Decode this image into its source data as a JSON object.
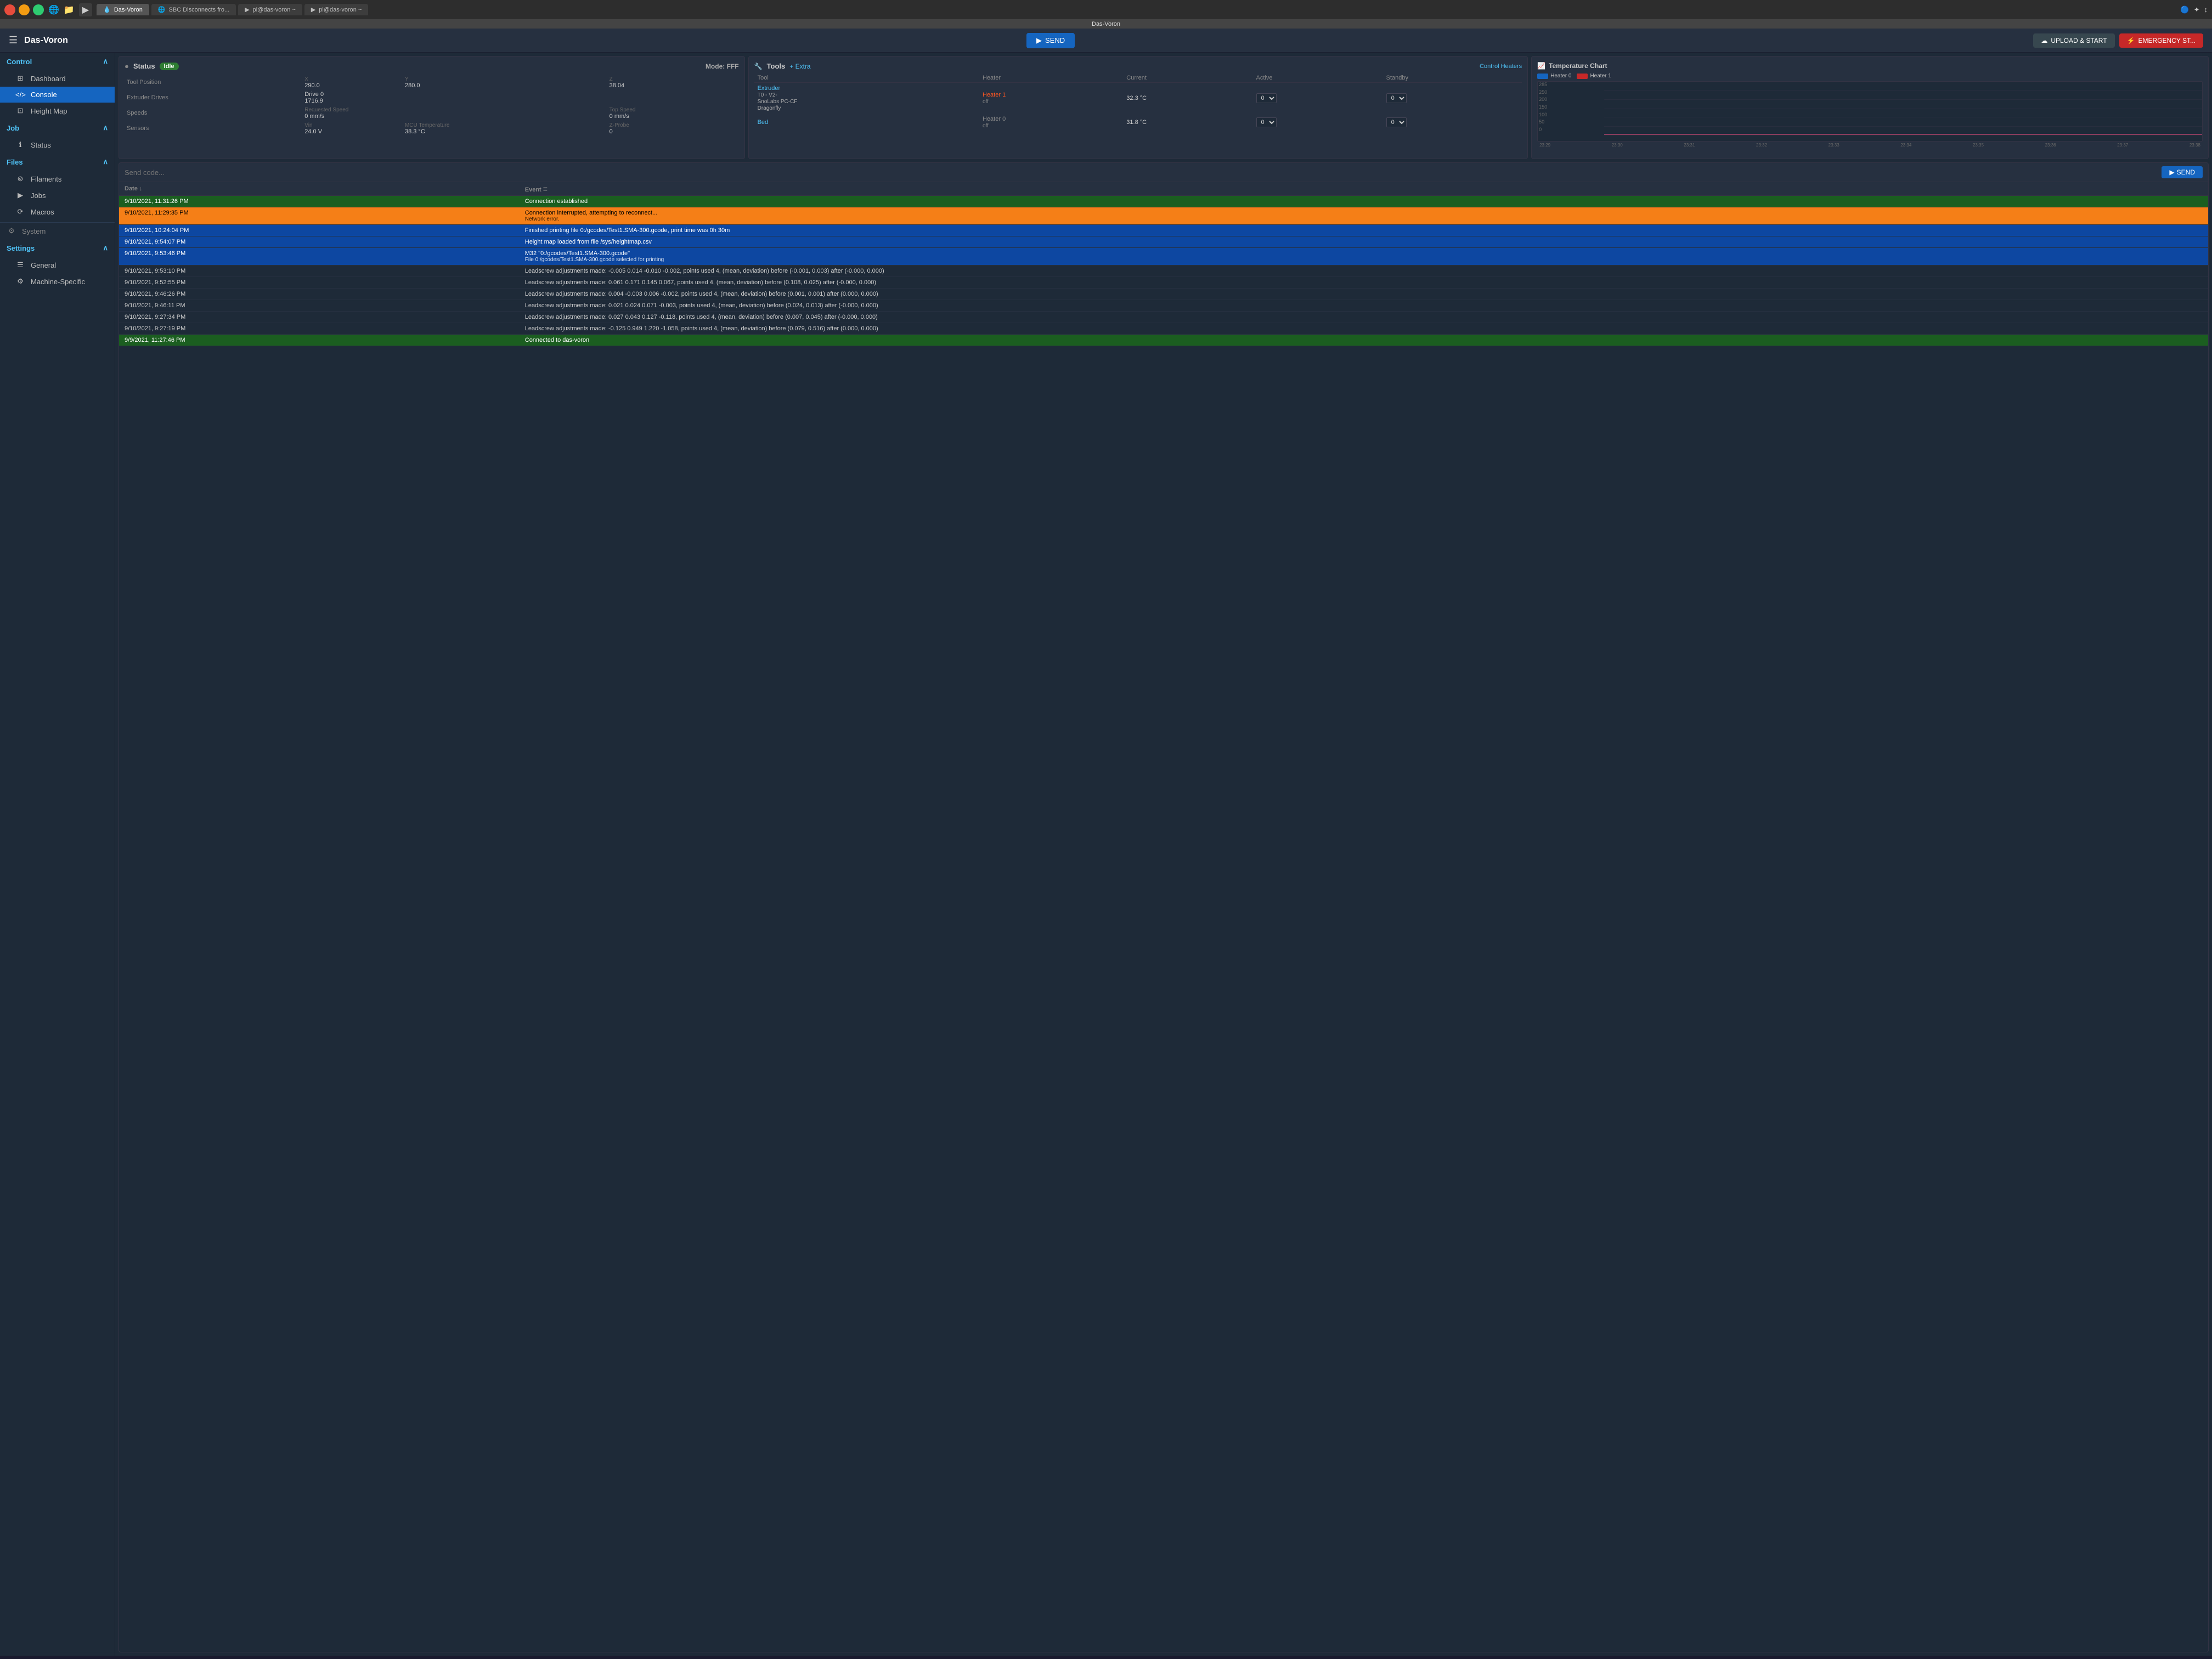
{
  "os_bar": {
    "tabs": [
      {
        "id": "tab1",
        "label": "Das-Voron",
        "active": true,
        "icon": "💧"
      },
      {
        "id": "tab2",
        "label": "SBC Disconnects fro...",
        "active": false,
        "icon": "🌐"
      },
      {
        "id": "tab3",
        "label": "pi@das-voron ~",
        "active": false,
        "icon": "▶"
      },
      {
        "id": "tab4",
        "label": "pi@das-voron ~",
        "active": false,
        "icon": "▶"
      }
    ],
    "title_bar": "Das-Voron",
    "right_icons": [
      "🔵",
      "✦",
      "↕"
    ]
  },
  "header": {
    "title": "Das-Voron",
    "send_label": "SEND",
    "upload_label": "UPLOAD & START",
    "emergency_label": "EMERGENCY ST..."
  },
  "sidebar": {
    "sections": [
      {
        "label": "Control",
        "items": [
          {
            "id": "dashboard",
            "label": "Dashboard",
            "icon": "⊞",
            "active": false
          },
          {
            "id": "console",
            "label": "Console",
            "icon": "</>",
            "active": true
          },
          {
            "id": "height-map",
            "label": "Height Map",
            "icon": "⊡",
            "active": false
          }
        ]
      },
      {
        "label": "Job",
        "items": [
          {
            "id": "status",
            "label": "Status",
            "icon": "ℹ",
            "active": false
          }
        ]
      },
      {
        "label": "Files",
        "items": [
          {
            "id": "filaments",
            "label": "Filaments",
            "icon": "⊚",
            "active": false
          },
          {
            "id": "jobs",
            "label": "Jobs",
            "icon": "▶",
            "active": false
          },
          {
            "id": "macros",
            "label": "Macros",
            "icon": "⟳",
            "active": false
          }
        ]
      },
      {
        "label": "Settings",
        "items": [
          {
            "id": "system",
            "label": "System",
            "icon": "⚙",
            "active": false
          },
          {
            "id": "general",
            "label": "General",
            "icon": "☰",
            "active": false
          },
          {
            "id": "machine-specific",
            "label": "Machine-Specific",
            "icon": "⚙",
            "active": false
          }
        ]
      }
    ]
  },
  "status": {
    "title": "Status",
    "badge": "Idle",
    "mode": "Mode: FFF",
    "tool_position": {
      "label": "Tool Position",
      "x_label": "X",
      "x_val": "290.0",
      "y_label": "Y",
      "y_val": "280.0",
      "z_label": "Z",
      "z_val": "38.04"
    },
    "extruder_drives": {
      "label": "Extruder Drives",
      "drive": "Drive 0",
      "drive_val": "1716.9"
    },
    "speeds": {
      "label": "Speeds",
      "requested_label": "Requested Speed",
      "requested_val": "0 mm/s",
      "top_label": "Top Speed",
      "top_val": "0 mm/s"
    },
    "sensors": {
      "label": "Sensors",
      "vin_label": "Vin",
      "vin_val": "24.0 V",
      "mcu_label": "MCU Temperature",
      "mcu_val": "38.3 °C",
      "zprobe_label": "Z-Probe",
      "zprobe_val": "0"
    }
  },
  "tools": {
    "title": "Tools",
    "extra_label": "+ Extra",
    "control_heaters_label": "Control Heaters",
    "columns": [
      "Tool",
      "Heater",
      "Current",
      "Active",
      "Standby"
    ],
    "rows": [
      {
        "tool_name": "Extruder",
        "tool_detail": "T0 - V2-SnoLabs PC-CF Dragonfly",
        "heater": "Heater 1",
        "heater_state": "off",
        "current": "32.3 °C",
        "active": "0",
        "standby": "0"
      },
      {
        "tool_name": "Bed",
        "tool_detail": "",
        "heater": "Heater 0",
        "heater_state": "off",
        "current": "31.8 °C",
        "active": "0",
        "standby": "0"
      }
    ]
  },
  "temp_chart": {
    "title": "Temperature Chart",
    "legend": [
      {
        "label": "Heater 0",
        "color": "#1565c0"
      },
      {
        "label": "Heater 1",
        "color": "#c62828"
      }
    ],
    "y_labels": [
      "285",
      "250",
      "200",
      "150",
      "100",
      "50",
      "0"
    ],
    "x_labels": [
      "23:29",
      "23:30",
      "23:31",
      "23:32",
      "23:33",
      "23:34",
      "23:35",
      "23:36",
      "23:37",
      "23:38"
    ]
  },
  "console": {
    "send_placeholder": "Send code...",
    "send_label": "SEND",
    "log_columns": [
      "Date ↓",
      "Event"
    ],
    "log_rows": [
      {
        "date": "9/10/2021, 11:31:26 PM",
        "event": "Connection established",
        "sub": "",
        "style": "green"
      },
      {
        "date": "9/10/2021, 11:29:35 PM",
        "event": "Connection interrupted, attempting to reconnect...",
        "sub": "Network error.",
        "style": "yellow"
      },
      {
        "date": "9/10/2021, 10:24:04 PM",
        "event": "Finished printing file 0:/gcodes/Test1.SMA-300.gcode, print time was 0h 30m",
        "sub": "",
        "style": "blue"
      },
      {
        "date": "9/10/2021, 9:54:07 PM",
        "event": "Height map loaded from file /sys/heightmap.csv",
        "sub": "",
        "style": "blue"
      },
      {
        "date": "9/10/2021, 9:53:46 PM",
        "event": "M32 \"0:/gcodes/Test1.SMA-300.gcode\"",
        "sub": "File 0:/gcodes/Test1.SMA-300.gcode selected for printing",
        "style": "blue"
      },
      {
        "date": "9/10/2021, 9:53:10 PM",
        "event": "Leadscrew adjustments made: -0.005 0.014 -0.010 -0.002, points used 4, (mean, deviation) before (-0.001, 0.003) after (-0.000, 0.000)",
        "sub": "",
        "style": "default"
      },
      {
        "date": "9/10/2021, 9:52:55 PM",
        "event": "Leadscrew adjustments made: 0.061 0.171 0.145 0.067, points used 4, (mean, deviation) before (0.108, 0.025) after (-0.000, 0.000)",
        "sub": "",
        "style": "default"
      },
      {
        "date": "9/10/2021, 9:46:26 PM",
        "event": "Leadscrew adjustments made: 0.004 -0.003 0.006 -0.002, points used 4, (mean, deviation) before (0.001, 0.001) after (0.000, 0.000)",
        "sub": "",
        "style": "default"
      },
      {
        "date": "9/10/2021, 9:46:11 PM",
        "event": "Leadscrew adjustments made: 0.021 0.024 0.071 -0.003, points used 4, (mean, deviation) before (0.024, 0.013) after (-0.000, 0.000)",
        "sub": "",
        "style": "default"
      },
      {
        "date": "9/10/2021, 9:27:34 PM",
        "event": "Leadscrew adjustments made: 0.027 0.043 0.127 -0.118, points used 4, (mean, deviation) before (0.007, 0.045) after (-0.000, 0.000)",
        "sub": "",
        "style": "default"
      },
      {
        "date": "9/10/2021, 9:27:19 PM",
        "event": "Leadscrew adjustments made: -0.125 0.949 1.220 -1.058, points used 4, (mean, deviation) before (0.079, 0.516) after (0.000, 0.000)",
        "sub": "",
        "style": "default"
      },
      {
        "date": "9/9/2021, 11:27:46 PM",
        "event": "Connected to das-voron",
        "sub": "",
        "style": "green"
      }
    ]
  }
}
